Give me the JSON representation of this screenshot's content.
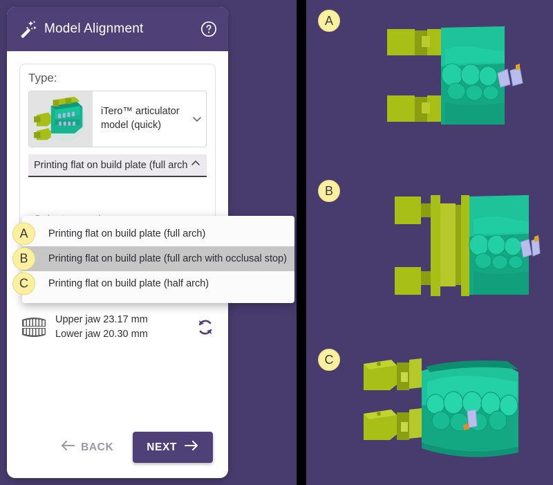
{
  "window": {
    "title": "Model Alignment",
    "wand_icon": "magic-wand-icon",
    "help_icon": "help-circle-icon",
    "header_color": "#4f4178",
    "background_color": "#483c6e"
  },
  "form": {
    "type_label": "Type:",
    "model": {
      "name": "iTero™ articulator model (quick)",
      "thumbnail_icon": "articulator-model-thumbnail",
      "chevron_icon": "chevron-down-icon"
    },
    "orientation_select": {
      "value": "Printing flat on build plate (full arch",
      "chevron_icon": "chevron-up-icon",
      "expanded": true
    },
    "secondary_select": {
      "placeholder": "Select an option",
      "chevron_icon": "chevron-down-icon",
      "disabled": true
    },
    "dropdown_options": [
      {
        "badge": "A",
        "label": "Printing flat on build plate (full arch)",
        "highlighted": false
      },
      {
        "badge": "B",
        "label": "Printing flat on build plate (full arch with occlusal stop)",
        "highlighted": true
      },
      {
        "badge": "C",
        "label": "Printing flat on build plate (half arch)",
        "highlighted": false
      }
    ]
  },
  "measurements": {
    "jaw_icon": "dental-arch-icon",
    "upper": "Upper jaw 23.17 mm",
    "lower": "Lower jaw 20.30 mm",
    "reset_icon": "refresh-rotate-icon"
  },
  "footer": {
    "back_label": "BACK",
    "back_arrow_icon": "arrow-left-icon",
    "next_label": "NEXT",
    "next_arrow_icon": "arrow-right-icon",
    "next_color": "#4f4178"
  },
  "previews": [
    {
      "badge": "A",
      "variant": "full-arch",
      "base_color": "#16b48c",
      "support_color": "#a8bf17"
    },
    {
      "badge": "B",
      "variant": "full-arch-occlusal-stop",
      "base_color": "#16b48c",
      "support_color": "#a8bf17"
    },
    {
      "badge": "C",
      "variant": "half-arch",
      "base_color": "#16b48c",
      "support_color": "#a8bf17"
    }
  ]
}
